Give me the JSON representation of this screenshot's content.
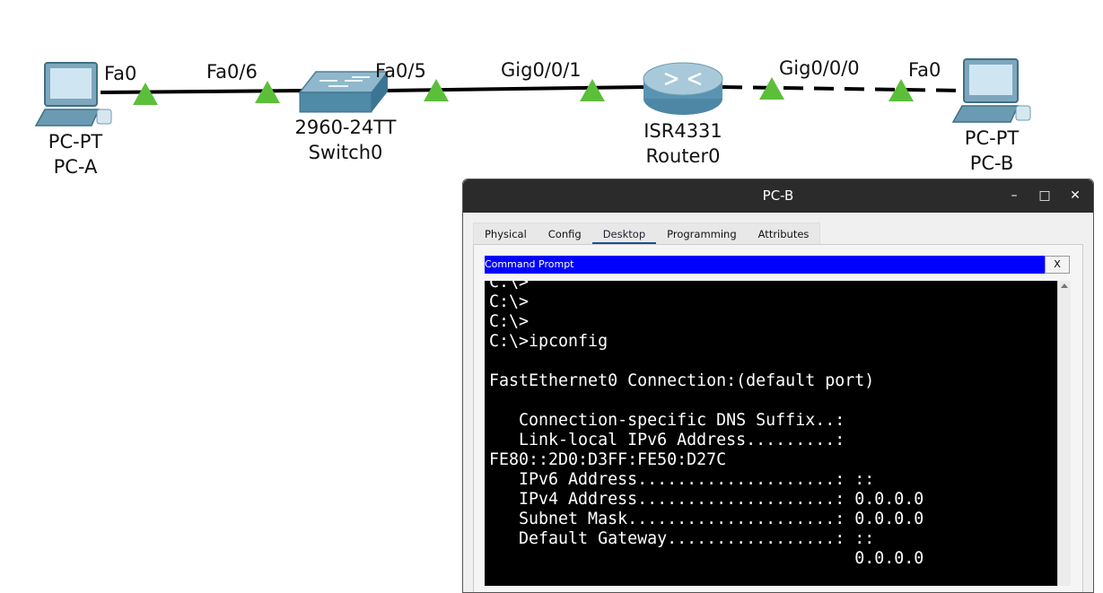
{
  "topology": {
    "port_labels": {
      "pca_port": "Fa0",
      "switch_left_port": "Fa0/6",
      "switch_right_port": "Fa0/5",
      "router_left_port": "Gig0/0/1",
      "router_right_port": "Gig0/0/0",
      "pcb_port": "Fa0"
    },
    "devices": {
      "pc_a": {
        "model": "PC-PT",
        "name": "PC-A"
      },
      "switch": {
        "model": "2960-24TT",
        "name": "Switch0"
      },
      "router": {
        "model": "ISR4331",
        "name": "Router0"
      },
      "pc_b": {
        "model": "PC-PT",
        "name": "PC-B"
      }
    },
    "colors": {
      "link_indicator": "#5cbf3a",
      "link_line": "#000000"
    }
  },
  "window": {
    "title": "PC-B",
    "controls": {
      "minimize": "–",
      "maximize": "□",
      "close": "✕"
    },
    "tabs": [
      "Physical",
      "Config",
      "Desktop",
      "Programming",
      "Attributes"
    ],
    "active_tab": "Desktop",
    "app_title": "Command Prompt",
    "app_close": "X",
    "terminal_lines": [
      "C:\\>",
      "C:\\>",
      "C:\\>",
      "C:\\>ipconfig",
      "",
      "FastEthernet0 Connection:(default port)",
      "",
      "   Connection-specific DNS Suffix..:",
      "   Link-local IPv6 Address.........:",
      "FE80::2D0:D3FF:FE50:D27C",
      "   IPv6 Address....................: ::",
      "   IPv4 Address....................: 0.0.0.0",
      "   Subnet Mask.....................: 0.0.0.0",
      "   Default Gateway.................: ::",
      "                                     0.0.0.0"
    ]
  }
}
